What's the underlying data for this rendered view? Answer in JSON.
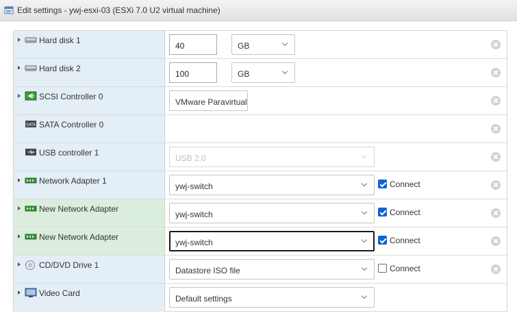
{
  "window": {
    "title": "Edit settings - ywj-esxi-03 (ESXi 7.0 U2 virtual machine)"
  },
  "devices": [
    {
      "label": "Hard disk 1",
      "icon": "hard-disk-icon",
      "value": "40",
      "unit": "GB"
    },
    {
      "label": "Hard disk 2",
      "icon": "hard-disk-icon",
      "value": "100",
      "unit": "GB"
    },
    {
      "label": "SCSI Controller 0",
      "icon": "scsi-controller-icon",
      "type": "VMware Paravirtual"
    },
    {
      "label": "SATA Controller 0",
      "icon": "sata-controller-icon"
    },
    {
      "label": "USB controller 1",
      "icon": "usb-controller-icon",
      "type": "USB 2.0"
    },
    {
      "label": "Network Adapter 1",
      "icon": "network-adapter-icon",
      "network": "ywj-switch",
      "connect_label": "Connect",
      "connected": true
    },
    {
      "label": "New Network Adapter",
      "icon": "network-adapter-icon",
      "network": "ywj-switch",
      "connect_label": "Connect",
      "connected": true
    },
    {
      "label": "New Network Adapter",
      "icon": "network-adapter-icon",
      "network": "ywj-switch",
      "connect_label": "Connect",
      "connected": true
    },
    {
      "label": "CD/DVD Drive 1",
      "icon": "cd-dvd-icon",
      "media": "Datastore ISO file",
      "connect_label": "Connect",
      "connected": false
    },
    {
      "label": "Video Card",
      "icon": "video-card-icon",
      "setting": "Default settings"
    }
  ],
  "colors": {
    "accent": "#0a66d6",
    "row_label_bg": "#e3eef6",
    "new_row_bg": "#dbeedd"
  }
}
